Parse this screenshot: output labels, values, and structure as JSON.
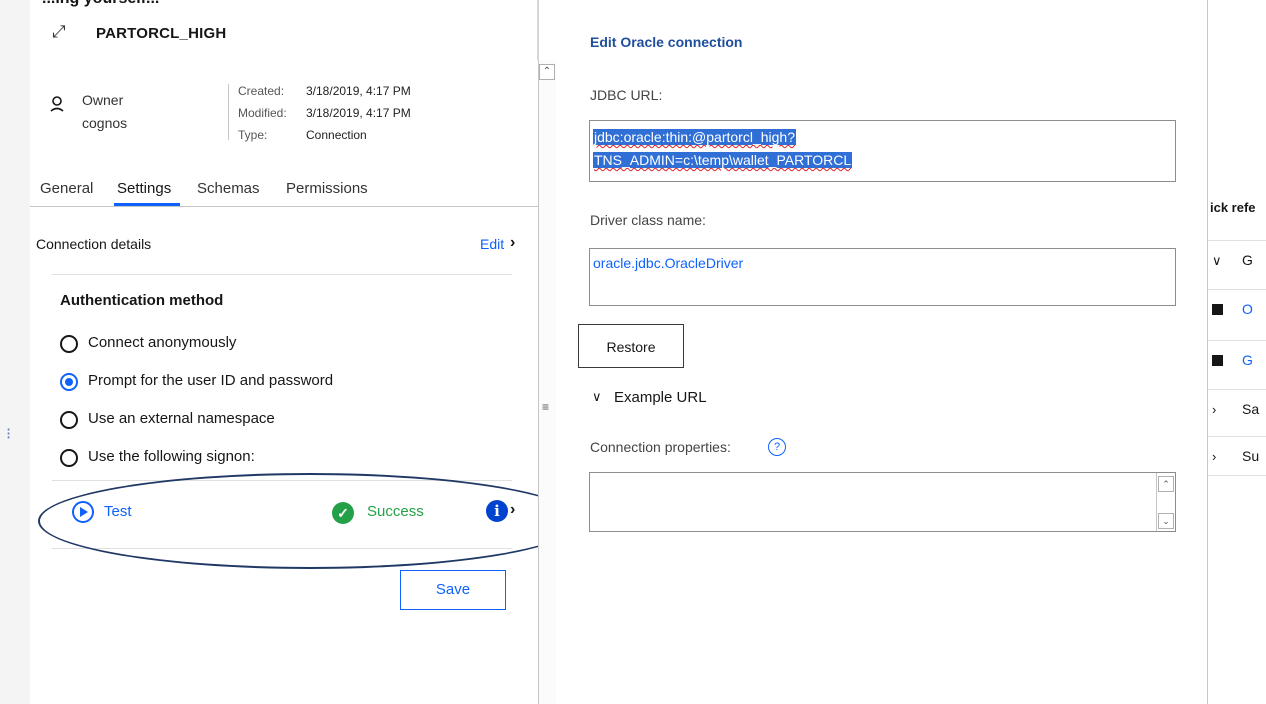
{
  "header": {
    "top_cut_text": "...ing yourself...",
    "title": "PARTORCL_HIGH",
    "owner_label": "Owner",
    "owner_name": "cognos",
    "meta": [
      {
        "key": "Created:",
        "value": "3/18/2019, 4:17 PM"
      },
      {
        "key": "Modified:",
        "value": "3/18/2019, 4:17 PM"
      },
      {
        "key": "Type:",
        "value": "Connection"
      }
    ]
  },
  "tabs": [
    "General",
    "Settings",
    "Schemas",
    "Permissions"
  ],
  "active_tab": "Settings",
  "settings": {
    "connection_details": "Connection details",
    "edit_label": "Edit",
    "auth_title": "Authentication method",
    "options": [
      {
        "label": "Connect anonymously",
        "checked": false
      },
      {
        "label": "Prompt for the user ID and password",
        "checked": true
      },
      {
        "label": "Use an external namespace",
        "checked": false
      },
      {
        "label": "Use the following signon:",
        "checked": false
      }
    ],
    "test_label": "Test",
    "success_label": "Success",
    "save_label": "Save"
  },
  "edit_panel": {
    "title": "Edit Oracle connection",
    "jdbc_label": "JDBC URL:",
    "jdbc_line1": "jdbc:oracle:thin:@partorcl_high?",
    "jdbc_line2": "TNS_ADMIN=c:\\temp\\wallet_PARTORCL",
    "driver_label": "Driver class name:",
    "driver_value": "oracle.jdbc.OracleDriver",
    "restore_label": "Restore",
    "example_label": "Example URL",
    "props_label": "Connection properties:",
    "props_value": ""
  },
  "quick_ref": {
    "title": "ick refe",
    "rows": [
      {
        "icon": "chevron-down-icon",
        "label": "G"
      },
      {
        "icon": "terminal-icon",
        "label": "O"
      },
      {
        "icon": "terminal-icon",
        "label": "G"
      },
      {
        "icon": "chevron-right-icon",
        "label": "Sa"
      },
      {
        "icon": "chevron-right-icon",
        "label": "Su"
      }
    ]
  },
  "colors": {
    "accent": "#0f62fe",
    "success": "#24a148",
    "info": "#0043ce",
    "annotation": "#1f3864"
  }
}
